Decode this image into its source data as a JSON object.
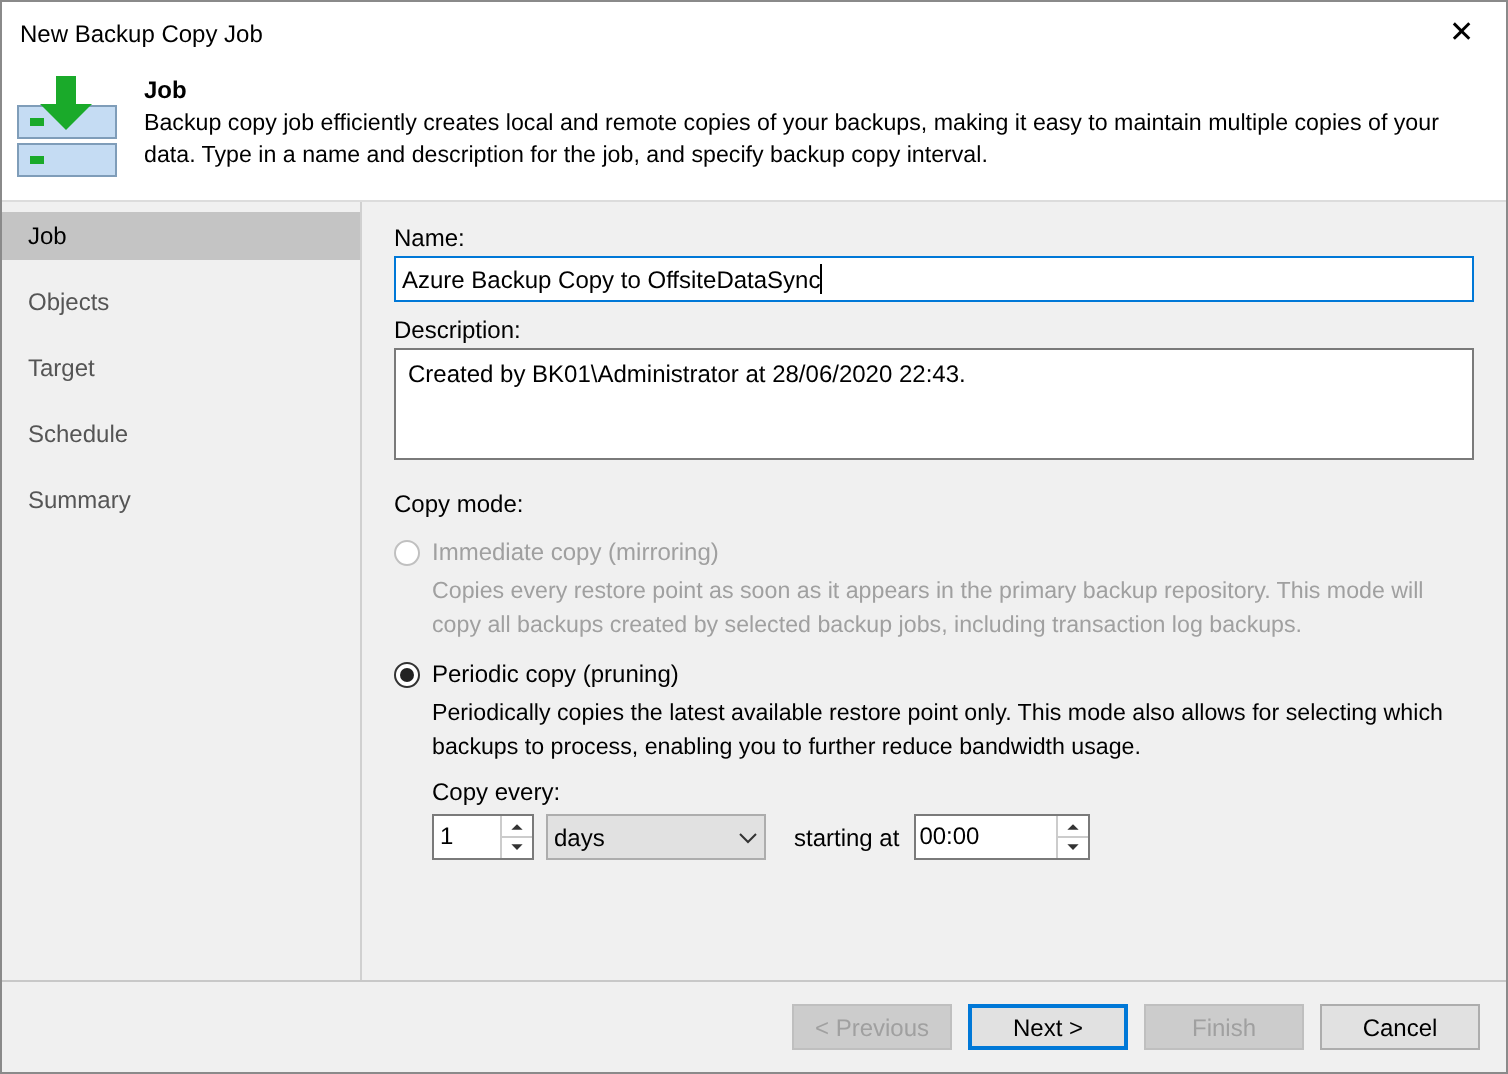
{
  "window": {
    "title": "New Backup Copy Job",
    "close": "✕"
  },
  "header": {
    "title": "Job",
    "description": "Backup copy job efficiently creates local and remote copies of your backups, making it easy to maintain multiple copies of your data. Type in a name and description for the job, and specify backup copy interval."
  },
  "sidebar": {
    "items": [
      {
        "label": "Job",
        "selected": true
      },
      {
        "label": "Objects",
        "selected": false
      },
      {
        "label": "Target",
        "selected": false
      },
      {
        "label": "Schedule",
        "selected": false
      },
      {
        "label": "Summary",
        "selected": false
      }
    ]
  },
  "form": {
    "name_label": "Name:",
    "name_value": "Azure Backup Copy to OffsiteDataSync",
    "description_label": "Description:",
    "description_value": "Created by BK01\\Administrator at 28/06/2020 22:43.",
    "copy_mode_label": "Copy mode:",
    "modes": [
      {
        "label": "Immediate copy (mirroring)",
        "description": "Copies every restore point as soon as it appears in the primary backup repository. This mode will copy all backups created by selected backup jobs, including transaction log backups.",
        "selected": false,
        "disabled": true
      },
      {
        "label": "Periodic copy (pruning)",
        "description": "Periodically copies the latest available restore point only. This mode also allows for selecting which backups to process, enabling you to further reduce bandwidth usage.",
        "selected": true,
        "disabled": false
      }
    ],
    "copy_every_label": "Copy every:",
    "copy_every_value": "1",
    "unit_value": "days",
    "starting_at_label": "starting at",
    "starting_at_value": "00:00"
  },
  "buttons": [
    {
      "label": "< Previous",
      "disabled": true,
      "default": false
    },
    {
      "label": "Next >",
      "disabled": false,
      "default": true
    },
    {
      "label": "Finish",
      "disabled": true,
      "default": false
    },
    {
      "label": "Cancel",
      "disabled": false,
      "default": false
    }
  ]
}
